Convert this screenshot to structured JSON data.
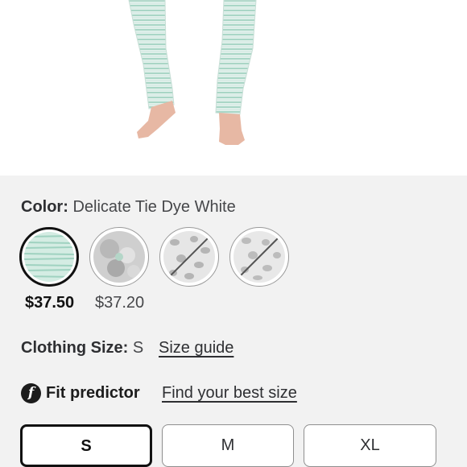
{
  "product": {
    "image_alt": "model-legs-pajama-pants"
  },
  "color": {
    "label": "Color:",
    "selected_value": "Delicate Tie Dye White",
    "swatches": [
      {
        "name": "mint-stripe",
        "price": "$37.50",
        "selected": true,
        "available": true
      },
      {
        "name": "grey-floral",
        "price": "$37.20",
        "selected": false,
        "available": true
      },
      {
        "name": "grey-leopard-1",
        "price": "",
        "selected": false,
        "available": false
      },
      {
        "name": "grey-leopard-2",
        "price": "",
        "selected": false,
        "available": false
      }
    ]
  },
  "clothing_size": {
    "label": "Clothing Size:",
    "selected_value": "S",
    "guide_link": "Size guide"
  },
  "fit_predictor": {
    "icon_letter": "f",
    "label": "Fit predictor",
    "link": "Find your best size"
  },
  "size_options": [
    {
      "label": "S",
      "selected": true
    },
    {
      "label": "M",
      "selected": false
    },
    {
      "label": "XL",
      "selected": false
    }
  ],
  "colors": {
    "background": "#f2f2f2",
    "text": "#2e2f32",
    "selected_border": "#111111",
    "mint": "#b8e0d2"
  }
}
